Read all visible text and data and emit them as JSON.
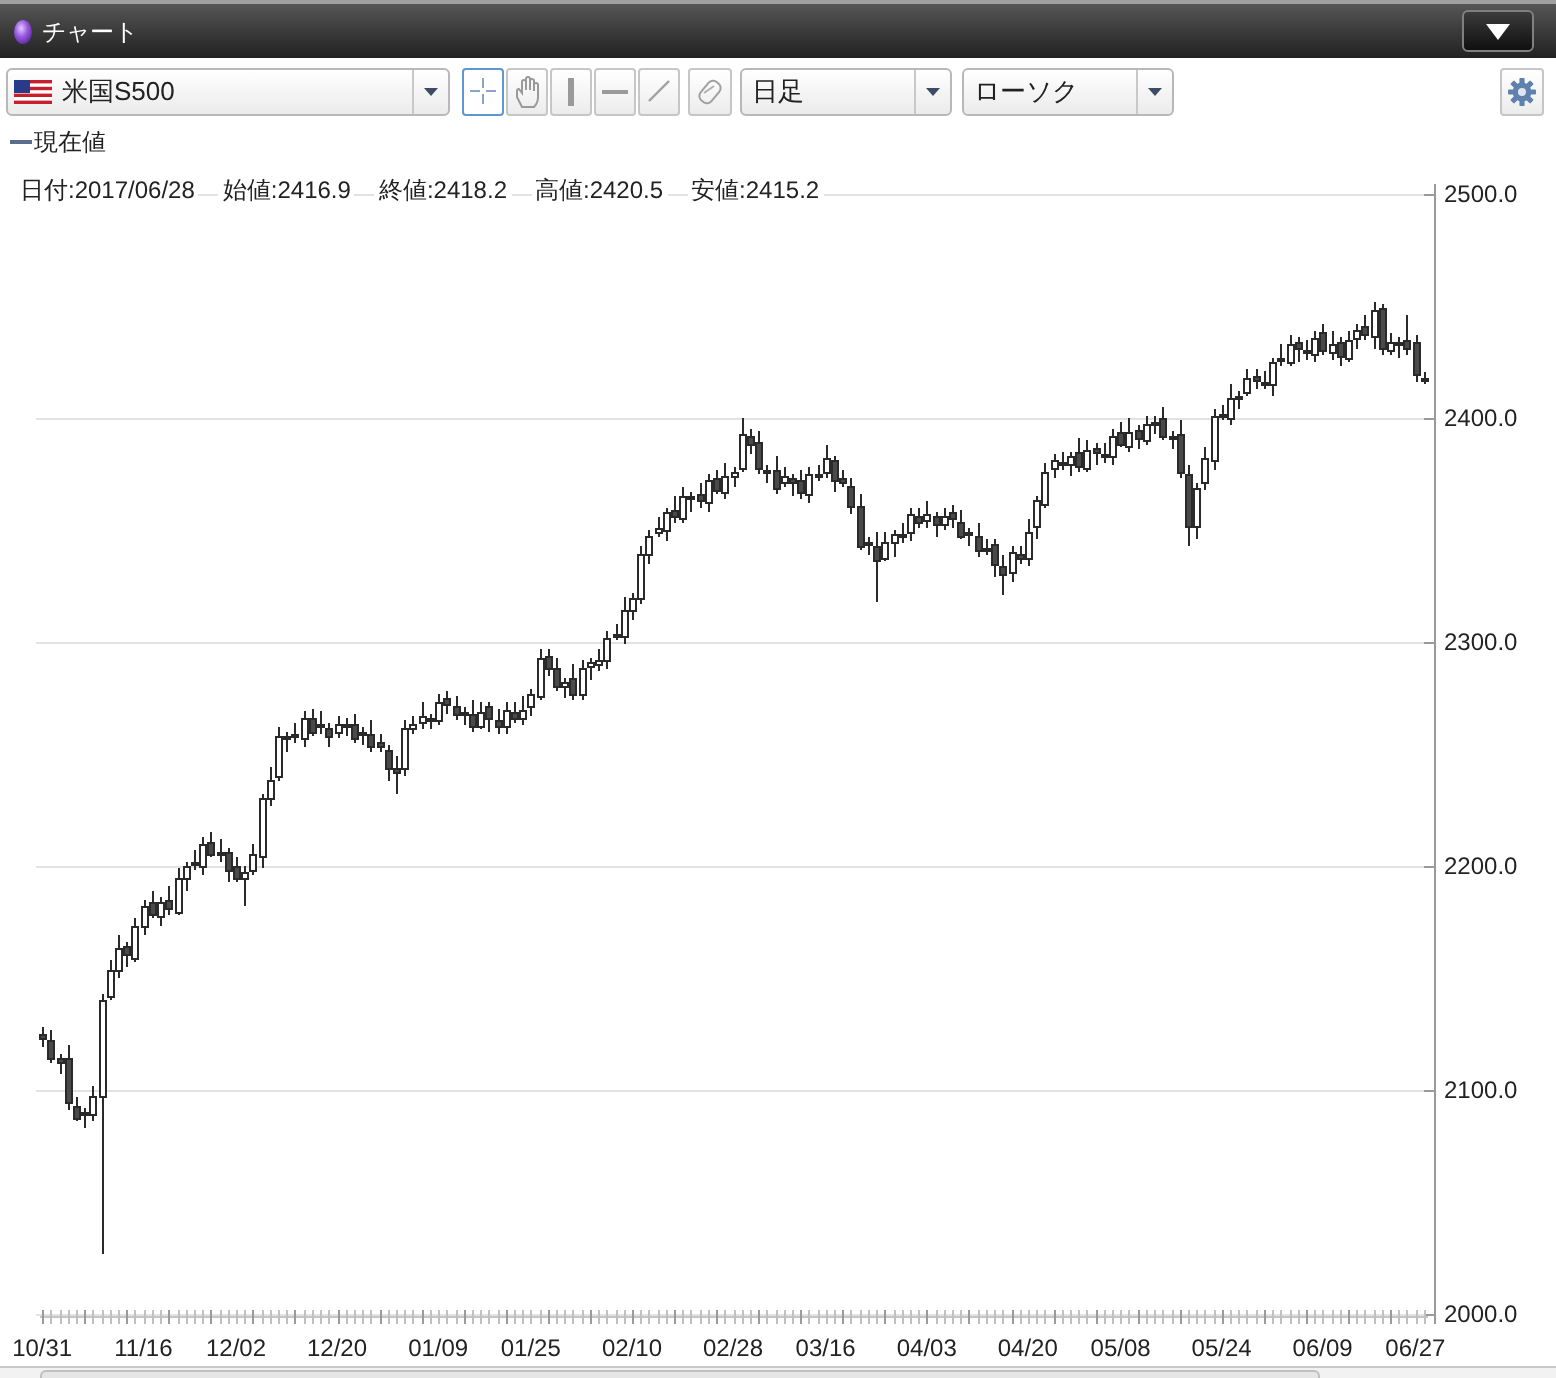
{
  "window": {
    "title": "チャート"
  },
  "toolbar": {
    "symbol": {
      "value": "米国S500"
    },
    "drawing_tools": [
      {
        "kind": "crosshair",
        "selected": true
      },
      {
        "kind": "hand",
        "selected": false
      },
      {
        "kind": "vertical_line",
        "selected": false
      },
      {
        "kind": "horizontal_line",
        "selected": false
      },
      {
        "kind": "diagonal_line",
        "selected": false
      }
    ],
    "period": {
      "value": "日足"
    },
    "chart_style": {
      "value": "ローソク"
    }
  },
  "legend": {
    "label": "現在値"
  },
  "ohlc_info": [
    "日付:2017/06/28",
    "始値:2416.9",
    "終値:2418.2",
    "高値:2420.5",
    "安値:2415.2"
  ],
  "chart": {
    "chart_data": {
      "type": "candlestick",
      "grid": true,
      "categories": [
        "10/31",
        null,
        null,
        null,
        null,
        null,
        null,
        null,
        null,
        null,
        null,
        null,
        "11/16",
        null,
        null,
        null,
        null,
        null,
        null,
        null,
        null,
        null,
        null,
        "12/02",
        null,
        null,
        null,
        null,
        null,
        null,
        null,
        null,
        null,
        null,
        null,
        "12/20",
        null,
        null,
        null,
        null,
        null,
        null,
        null,
        null,
        null,
        null,
        null,
        "01/09",
        null,
        null,
        null,
        null,
        null,
        null,
        null,
        null,
        null,
        null,
        "01/25",
        null,
        null,
        null,
        null,
        null,
        null,
        null,
        null,
        null,
        null,
        null,
        "02/10",
        null,
        null,
        null,
        null,
        null,
        null,
        null,
        null,
        null,
        null,
        null,
        "02/28",
        null,
        null,
        null,
        null,
        null,
        null,
        null,
        null,
        null,
        null,
        "03/16",
        null,
        null,
        null,
        null,
        null,
        null,
        null,
        null,
        null,
        null,
        null,
        "04/03",
        null,
        null,
        null,
        null,
        null,
        null,
        null,
        null,
        null,
        null,
        null,
        "04/20",
        null,
        null,
        null,
        null,
        null,
        null,
        null,
        null,
        null,
        null,
        "05/08",
        null,
        null,
        null,
        null,
        null,
        null,
        null,
        null,
        null,
        null,
        null,
        "05/24",
        null,
        null,
        null,
        null,
        null,
        null,
        null,
        null,
        null,
        null,
        null,
        "06/09",
        null,
        null,
        null,
        null,
        null,
        null,
        null,
        null,
        null,
        null,
        "06/27",
        null
      ],
      "ohlc": [
        [
          2125,
          2128,
          2119,
          2123
        ],
        [
          2122,
          2127,
          2112,
          2114
        ],
        [
          2114,
          2116,
          2107,
          2112
        ],
        [
          2114,
          2120,
          2091,
          2094
        ],
        [
          2093,
          2097,
          2086,
          2088
        ],
        [
          2089,
          2092,
          2083,
          2090
        ],
        [
          2089,
          2102,
          2086,
          2097
        ],
        [
          2097,
          2143,
          2027,
          2140
        ],
        [
          2142,
          2158,
          2140,
          2154
        ],
        [
          2153,
          2169,
          2150,
          2163
        ],
        [
          2164,
          2166,
          2155,
          2160
        ],
        [
          2159,
          2177,
          2157,
          2173
        ],
        [
          2173,
          2185,
          2169,
          2182
        ],
        [
          2184,
          2189,
          2177,
          2179
        ],
        [
          2178,
          2186,
          2173,
          2184
        ],
        [
          2185,
          2191,
          2178,
          2181
        ],
        [
          2180,
          2199,
          2178,
          2195
        ],
        [
          2195,
          2202,
          2189,
          2200
        ],
        [
          2202,
          2207,
          2198,
          2201
        ],
        [
          2200,
          2213,
          2196,
          2210
        ],
        [
          2211,
          2215,
          2204,
          2206
        ],
        [
          2205,
          2212,
          2202,
          2206
        ],
        [
          2206,
          2208,
          2193,
          2198
        ],
        [
          2200,
          2204,
          2193,
          2195
        ],
        [
          2194,
          2200,
          2182,
          2197
        ],
        [
          2198,
          2210,
          2196,
          2205
        ],
        [
          2204,
          2232,
          2199,
          2230
        ],
        [
          2230,
          2244,
          2227,
          2238
        ],
        [
          2240,
          2262,
          2238,
          2258
        ],
        [
          2257,
          2260,
          2251,
          2258
        ],
        [
          2259,
          2264,
          2255,
          2258
        ],
        [
          2257,
          2269,
          2253,
          2266
        ],
        [
          2266,
          2270,
          2258,
          2260
        ],
        [
          2262,
          2269,
          2259,
          2263
        ],
        [
          2262,
          2264,
          2253,
          2258
        ],
        [
          2259,
          2267,
          2257,
          2263
        ],
        [
          2262,
          2266,
          2258,
          2263
        ],
        [
          2263,
          2268,
          2255,
          2257
        ],
        [
          2259,
          2262,
          2254,
          2260
        ],
        [
          2259,
          2265,
          2251,
          2254
        ],
        [
          2255,
          2259,
          2251,
          2253
        ],
        [
          2252,
          2254,
          2238,
          2244
        ],
        [
          2244,
          2249,
          2232,
          2242
        ],
        [
          2244,
          2265,
          2240,
          2262
        ],
        [
          2261,
          2267,
          2259,
          2263
        ],
        [
          2264,
          2273,
          2261,
          2267
        ],
        [
          2266,
          2268,
          2261,
          2265
        ],
        [
          2265,
          2277,
          2263,
          2273
        ],
        [
          2275,
          2278,
          2268,
          2272
        ],
        [
          2271,
          2276,
          2265,
          2267
        ],
        [
          2268,
          2271,
          2263,
          2269
        ],
        [
          2268,
          2274,
          2260,
          2263
        ],
        [
          2263,
          2273,
          2261,
          2269
        ],
        [
          2271,
          2273,
          2260,
          2266
        ],
        [
          2265,
          2270,
          2259,
          2262
        ],
        [
          2263,
          2273,
          2259,
          2270
        ],
        [
          2269,
          2273,
          2264,
          2266
        ],
        [
          2266,
          2276,
          2263,
          2270
        ],
        [
          2272,
          2279,
          2267,
          2277
        ],
        [
          2276,
          2297,
          2274,
          2293
        ],
        [
          2294,
          2297,
          2285,
          2289
        ],
        [
          2288,
          2293,
          2278,
          2280
        ],
        [
          2280,
          2284,
          2275,
          2282
        ],
        [
          2284,
          2290,
          2274,
          2277
        ],
        [
          2276,
          2292,
          2274,
          2288
        ],
        [
          2289,
          2293,
          2283,
          2291
        ],
        [
          2290,
          2297,
          2287,
          2292
        ],
        [
          2292,
          2305,
          2288,
          2302
        ],
        [
          2304,
          2308,
          2301,
          2303
        ],
        [
          2302,
          2320,
          2299,
          2314
        ],
        [
          2315,
          2322,
          2310,
          2320
        ],
        [
          2319,
          2343,
          2317,
          2339
        ],
        [
          2339,
          2350,
          2335,
          2347
        ],
        [
          2349,
          2356,
          2347,
          2351
        ],
        [
          2350,
          2360,
          2345,
          2358
        ],
        [
          2359,
          2365,
          2353,
          2356
        ],
        [
          2355,
          2369,
          2353,
          2365
        ],
        [
          2365,
          2367,
          2358,
          2364
        ],
        [
          2366,
          2371,
          2360,
          2363
        ],
        [
          2362,
          2375,
          2358,
          2372
        ],
        [
          2373,
          2377,
          2366,
          2368
        ],
        [
          2367,
          2380,
          2364,
          2374
        ],
        [
          2374,
          2378,
          2369,
          2376
        ],
        [
          2378,
          2400,
          2376,
          2393
        ],
        [
          2392,
          2395,
          2384,
          2388
        ],
        [
          2389,
          2394,
          2375,
          2377
        ],
        [
          2376,
          2379,
          2371,
          2377
        ],
        [
          2377,
          2383,
          2366,
          2369
        ],
        [
          2371,
          2378,
          2369,
          2374
        ],
        [
          2373,
          2375,
          2365,
          2371
        ],
        [
          2372,
          2377,
          2364,
          2367
        ],
        [
          2366,
          2378,
          2362,
          2375
        ],
        [
          2375,
          2379,
          2372,
          2374
        ],
        [
          2376,
          2388,
          2373,
          2382
        ],
        [
          2381,
          2383,
          2367,
          2372
        ],
        [
          2373,
          2377,
          2369,
          2371
        ],
        [
          2370,
          2373,
          2357,
          2361
        ],
        [
          2361,
          2366,
          2341,
          2343
        ],
        [
          2345,
          2347,
          2339,
          2344
        ],
        [
          2343,
          2349,
          2318,
          2337
        ],
        [
          2338,
          2349,
          2336,
          2345
        ],
        [
          2344,
          2350,
          2338,
          2348
        ],
        [
          2348,
          2353,
          2344,
          2347
        ],
        [
          2349,
          2360,
          2345,
          2357
        ],
        [
          2356,
          2360,
          2351,
          2353
        ],
        [
          2354,
          2363,
          2351,
          2357
        ],
        [
          2356,
          2358,
          2347,
          2352
        ],
        [
          2352,
          2360,
          2350,
          2356
        ],
        [
          2358,
          2361,
          2351,
          2355
        ],
        [
          2354,
          2359,
          2346,
          2348
        ],
        [
          2349,
          2351,
          2343,
          2348
        ],
        [
          2347,
          2353,
          2338,
          2341
        ],
        [
          2341,
          2346,
          2339,
          2342
        ],
        [
          2344,
          2346,
          2329,
          2335
        ],
        [
          2334,
          2339,
          2321,
          2330
        ],
        [
          2331,
          2343,
          2327,
          2340
        ],
        [
          2339,
          2343,
          2335,
          2337
        ],
        [
          2337,
          2355,
          2334,
          2349
        ],
        [
          2351,
          2365,
          2346,
          2363
        ],
        [
          2362,
          2380,
          2360,
          2376
        ],
        [
          2377,
          2384,
          2373,
          2381
        ],
        [
          2380,
          2385,
          2377,
          2379
        ],
        [
          2379,
          2385,
          2374,
          2383
        ],
        [
          2385,
          2391,
          2376,
          2379
        ],
        [
          2378,
          2390,
          2376,
          2386
        ],
        [
          2387,
          2389,
          2379,
          2385
        ],
        [
          2384,
          2389,
          2380,
          2383
        ],
        [
          2383,
          2395,
          2379,
          2392
        ],
        [
          2394,
          2398,
          2387,
          2389
        ],
        [
          2388,
          2400,
          2385,
          2394
        ],
        [
          2395,
          2397,
          2386,
          2391
        ],
        [
          2390,
          2401,
          2388,
          2397
        ],
        [
          2397,
          2401,
          2393,
          2398
        ],
        [
          2400,
          2405,
          2390,
          2392
        ],
        [
          2391,
          2394,
          2386,
          2392
        ],
        [
          2393,
          2399,
          2373,
          2376
        ],
        [
          2375,
          2379,
          2343,
          2352
        ],
        [
          2352,
          2371,
          2346,
          2369
        ],
        [
          2371,
          2387,
          2368,
          2382
        ],
        [
          2381,
          2404,
          2377,
          2401
        ],
        [
          2402,
          2406,
          2399,
          2401
        ],
        [
          2400,
          2415,
          2397,
          2409
        ],
        [
          2409,
          2412,
          2404,
          2410
        ],
        [
          2412,
          2422,
          2410,
          2418
        ],
        [
          2419,
          2422,
          2413,
          2417
        ],
        [
          2416,
          2421,
          2413,
          2415
        ],
        [
          2415,
          2427,
          2410,
          2425
        ],
        [
          2427,
          2433,
          2423,
          2426
        ],
        [
          2425,
          2437,
          2423,
          2433
        ],
        [
          2434,
          2436,
          2425,
          2431
        ],
        [
          2430,
          2435,
          2426,
          2429
        ],
        [
          2429,
          2439,
          2425,
          2436
        ],
        [
          2438,
          2442,
          2428,
          2430
        ],
        [
          2429,
          2439,
          2426,
          2433
        ],
        [
          2434,
          2436,
          2423,
          2428
        ],
        [
          2427,
          2439,
          2425,
          2435
        ],
        [
          2435,
          2442,
          2431,
          2439
        ],
        [
          2441,
          2446,
          2435,
          2437
        ],
        [
          2436,
          2452,
          2431,
          2448
        ],
        [
          2449,
          2451,
          2428,
          2431
        ],
        [
          2430,
          2438,
          2428,
          2434
        ],
        [
          2434,
          2436,
          2427,
          2433
        ],
        [
          2435,
          2446,
          2428,
          2431
        ],
        [
          2434,
          2437,
          2416,
          2420
        ],
        [
          2416.9,
          2420.5,
          2415.2,
          2418.2
        ]
      ],
      "ylim": [
        2000,
        2500
      ],
      "yticks": [
        {
          "value": 2500,
          "label": "2500.0"
        },
        {
          "value": 2400,
          "label": "2400.0"
        },
        {
          "value": 2300,
          "label": "2300.0"
        },
        {
          "value": 2200,
          "label": "2200.0"
        },
        {
          "value": 2100,
          "label": "2100.0"
        },
        {
          "value": 2000,
          "label": "2000.0"
        }
      ]
    }
  }
}
